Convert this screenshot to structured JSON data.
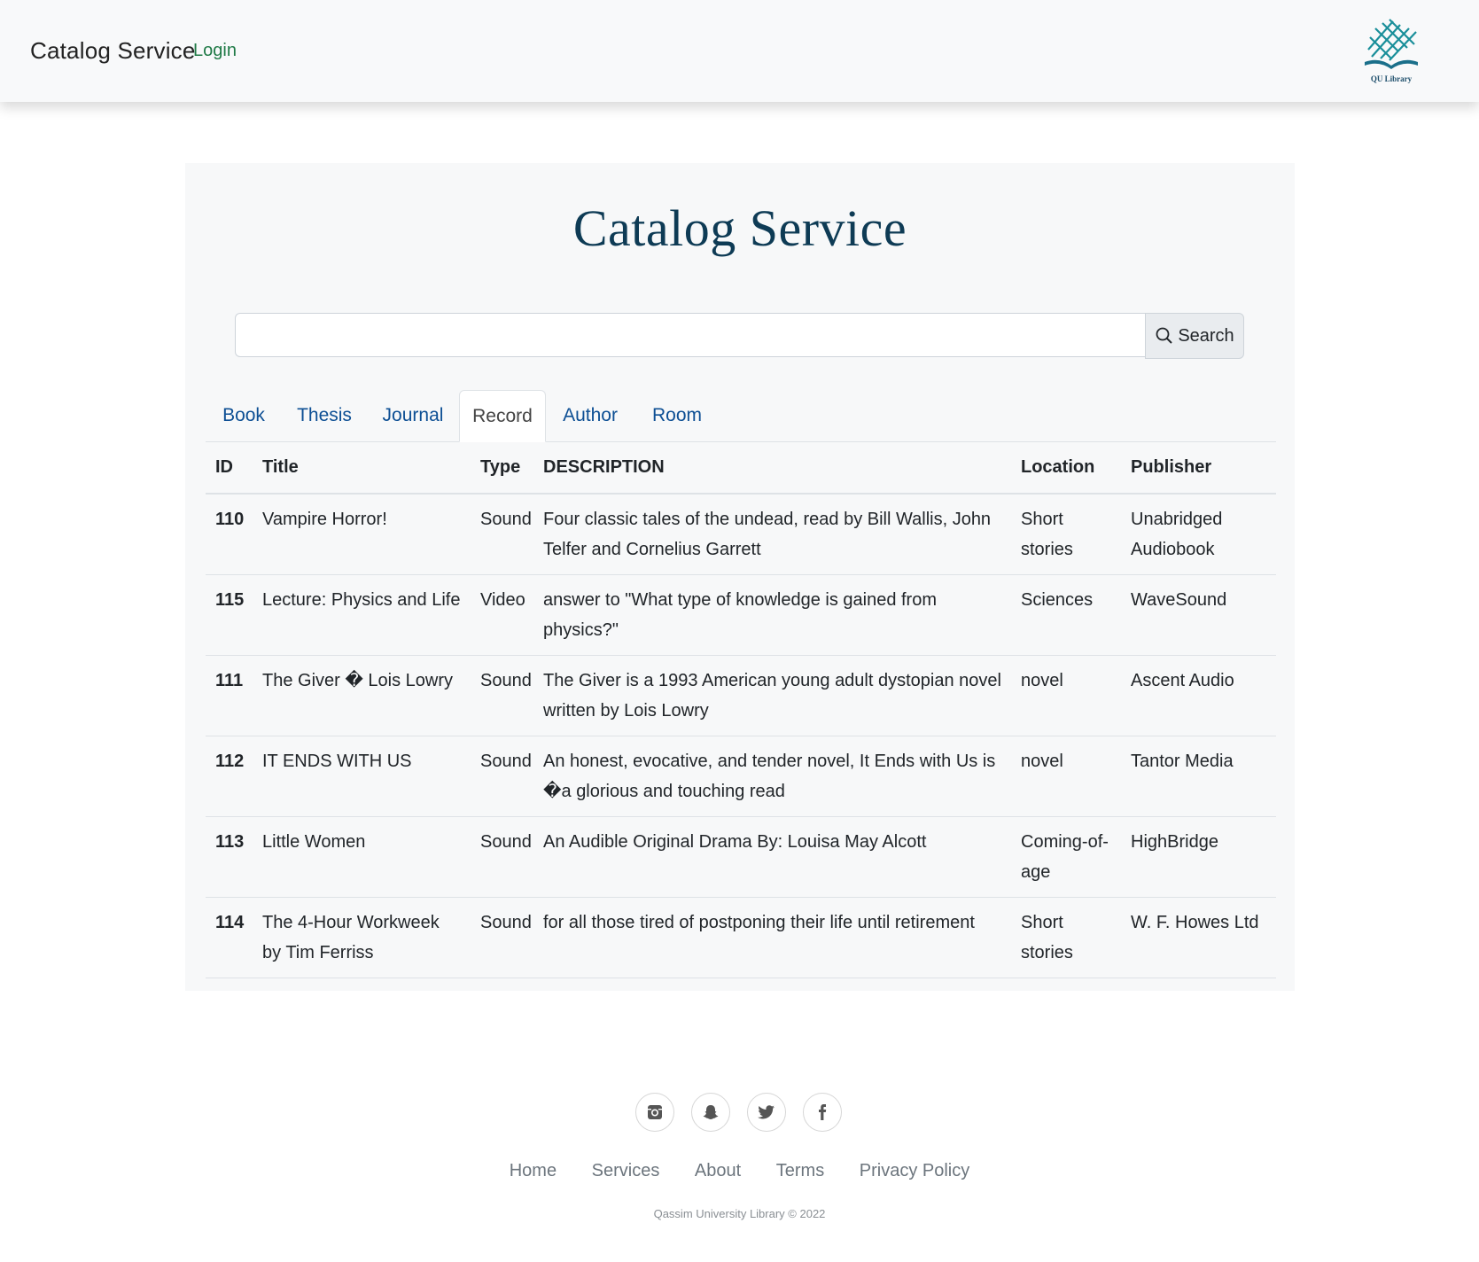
{
  "navbar": {
    "brand": "Catalog Service",
    "login": "Login",
    "logo_text": "QU Library"
  },
  "main": {
    "title": "Catalog Service",
    "search": {
      "value": "",
      "placeholder": "",
      "button_label": "Search"
    },
    "tabs": [
      {
        "label": "Book"
      },
      {
        "label": "Thesis"
      },
      {
        "label": "Journal"
      },
      {
        "label": "Record",
        "active": true
      },
      {
        "label": "Author"
      },
      {
        "label": "Room"
      }
    ],
    "table": {
      "columns": [
        "ID",
        "Title",
        "Type",
        "DESCRIPTION",
        "Location",
        "Publisher"
      ],
      "rows": [
        [
          "110",
          "Vampire Horror!",
          "Sound",
          "Four classic tales of the undead, read by Bill Wallis, John Telfer and Cornelius Garrett",
          "Short stories",
          "Unabridged Audiobook"
        ],
        [
          "115",
          "Lecture: Physics and Life",
          "Video",
          "answer to \"What type of knowledge is gained from physics?\"",
          "Sciences",
          "WaveSound"
        ],
        [
          "111",
          "The Giver � Lois Lowry",
          "Sound",
          "The Giver is a 1993 American young adult dystopian novel written by Lois Lowry",
          "novel",
          "Ascent Audio"
        ],
        [
          "112",
          "IT ENDS WITH US",
          "Sound",
          "An honest, evocative, and tender novel, It Ends with Us is �a glorious and touching read",
          "novel",
          "Tantor Media"
        ],
        [
          "113",
          "Little Women",
          "Sound",
          "An Audible Original Drama By: Louisa May Alcott",
          "Coming-of-age",
          "HighBridge"
        ],
        [
          "114",
          "The 4-Hour Workweek by Tim Ferriss",
          "Sound",
          "for all those tired of postponing their life until retirement",
          "Short stories",
          "W. F. Howes Ltd"
        ]
      ]
    }
  },
  "footer": {
    "socials": [
      "instagram-icon",
      "snapchat-icon",
      "twitter-icon",
      "facebook-icon"
    ],
    "links": [
      "Home",
      "Services",
      "About",
      "Terms",
      "Privacy Policy"
    ],
    "copyright": "Qassim University Library © 2022"
  },
  "colors": {
    "title": "#0e3b55",
    "tab_link": "#0d4f94",
    "login_link": "#1f7a46",
    "logo_teal": "#1a8f9a"
  }
}
